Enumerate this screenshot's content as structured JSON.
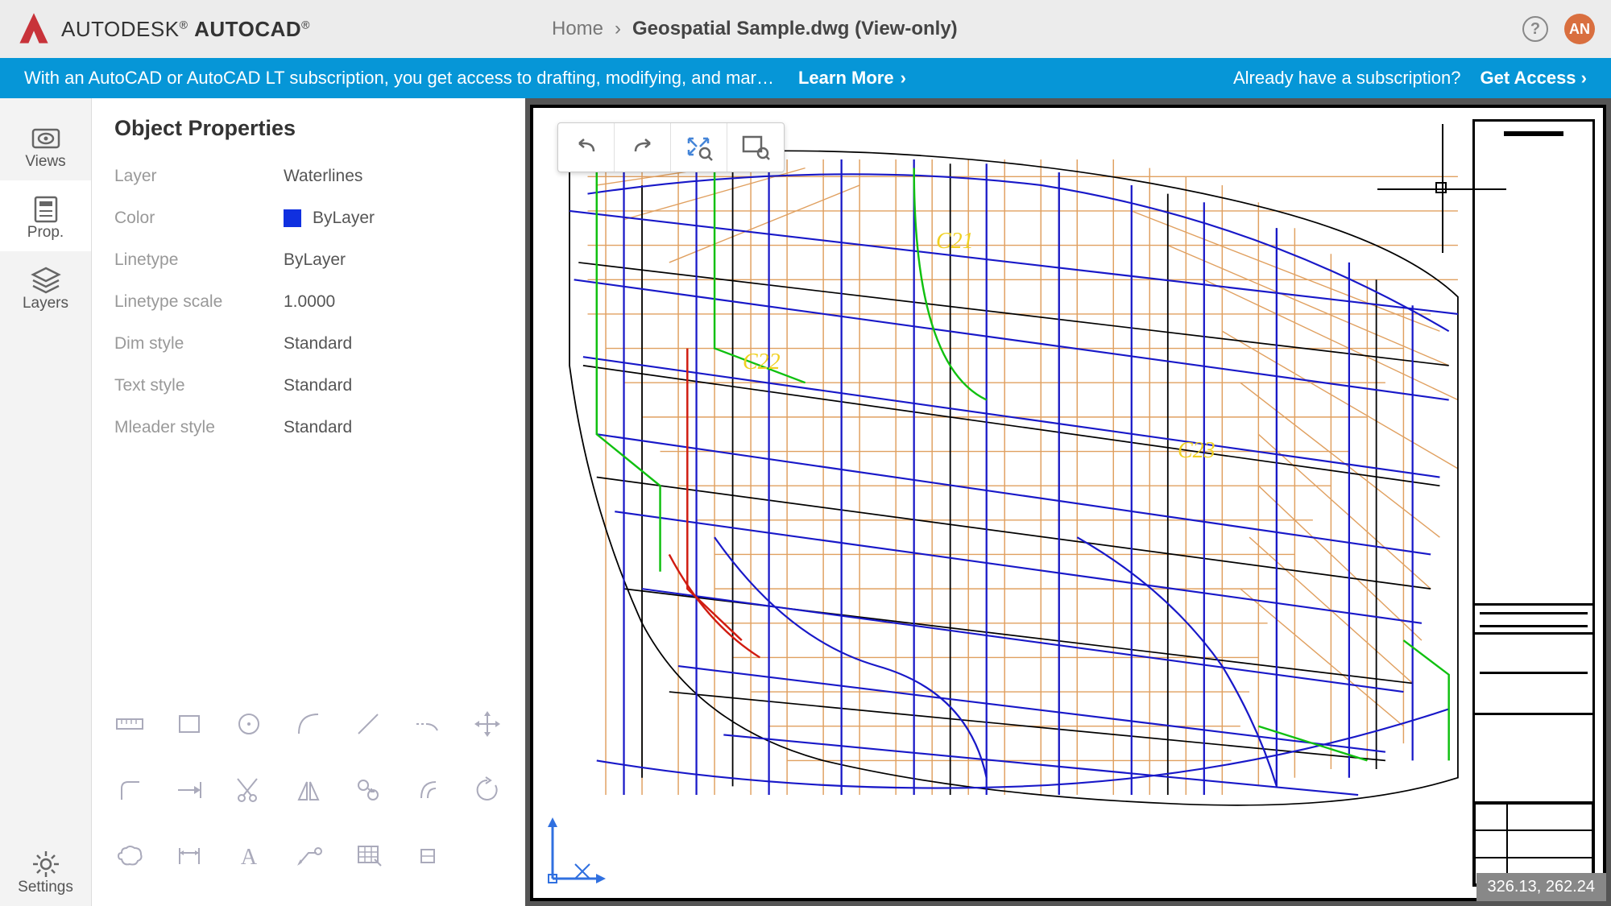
{
  "brand": {
    "light": "AUTODESK",
    "bold": "AUTOCAD",
    "reg": "®"
  },
  "breadcrumb": {
    "home": "Home",
    "sep": "›",
    "current": "Geospatial Sample.dwg (View-only)"
  },
  "avatar_initials": "AN",
  "promo": {
    "text": "With an AutoCAD or AutoCAD LT subscription, you get access to drafting, modifying, and mar…",
    "learn_more": "Learn More",
    "sub_prompt": "Already have a subscription?",
    "get_access": "Get Access"
  },
  "rail": {
    "views": "Views",
    "prop": "Prop.",
    "layers": "Layers",
    "settings": "Settings"
  },
  "panel": {
    "title": "Object Properties",
    "rows": {
      "layer_label": "Layer",
      "layer_value": "Waterlines",
      "color_label": "Color",
      "color_value": "ByLayer",
      "linetype_label": "Linetype",
      "linetype_value": "ByLayer",
      "ltscale_label": "Linetype scale",
      "ltscale_value": "1.0000",
      "dim_label": "Dim style",
      "dim_value": "Standard",
      "text_label": "Text style",
      "text_value": "Standard",
      "mleader_label": "Mleader style",
      "mleader_value": "Standard"
    }
  },
  "map_labels": {
    "a": "C21",
    "b": "C22",
    "c": "C23"
  },
  "coords": "326.13, 262.24"
}
